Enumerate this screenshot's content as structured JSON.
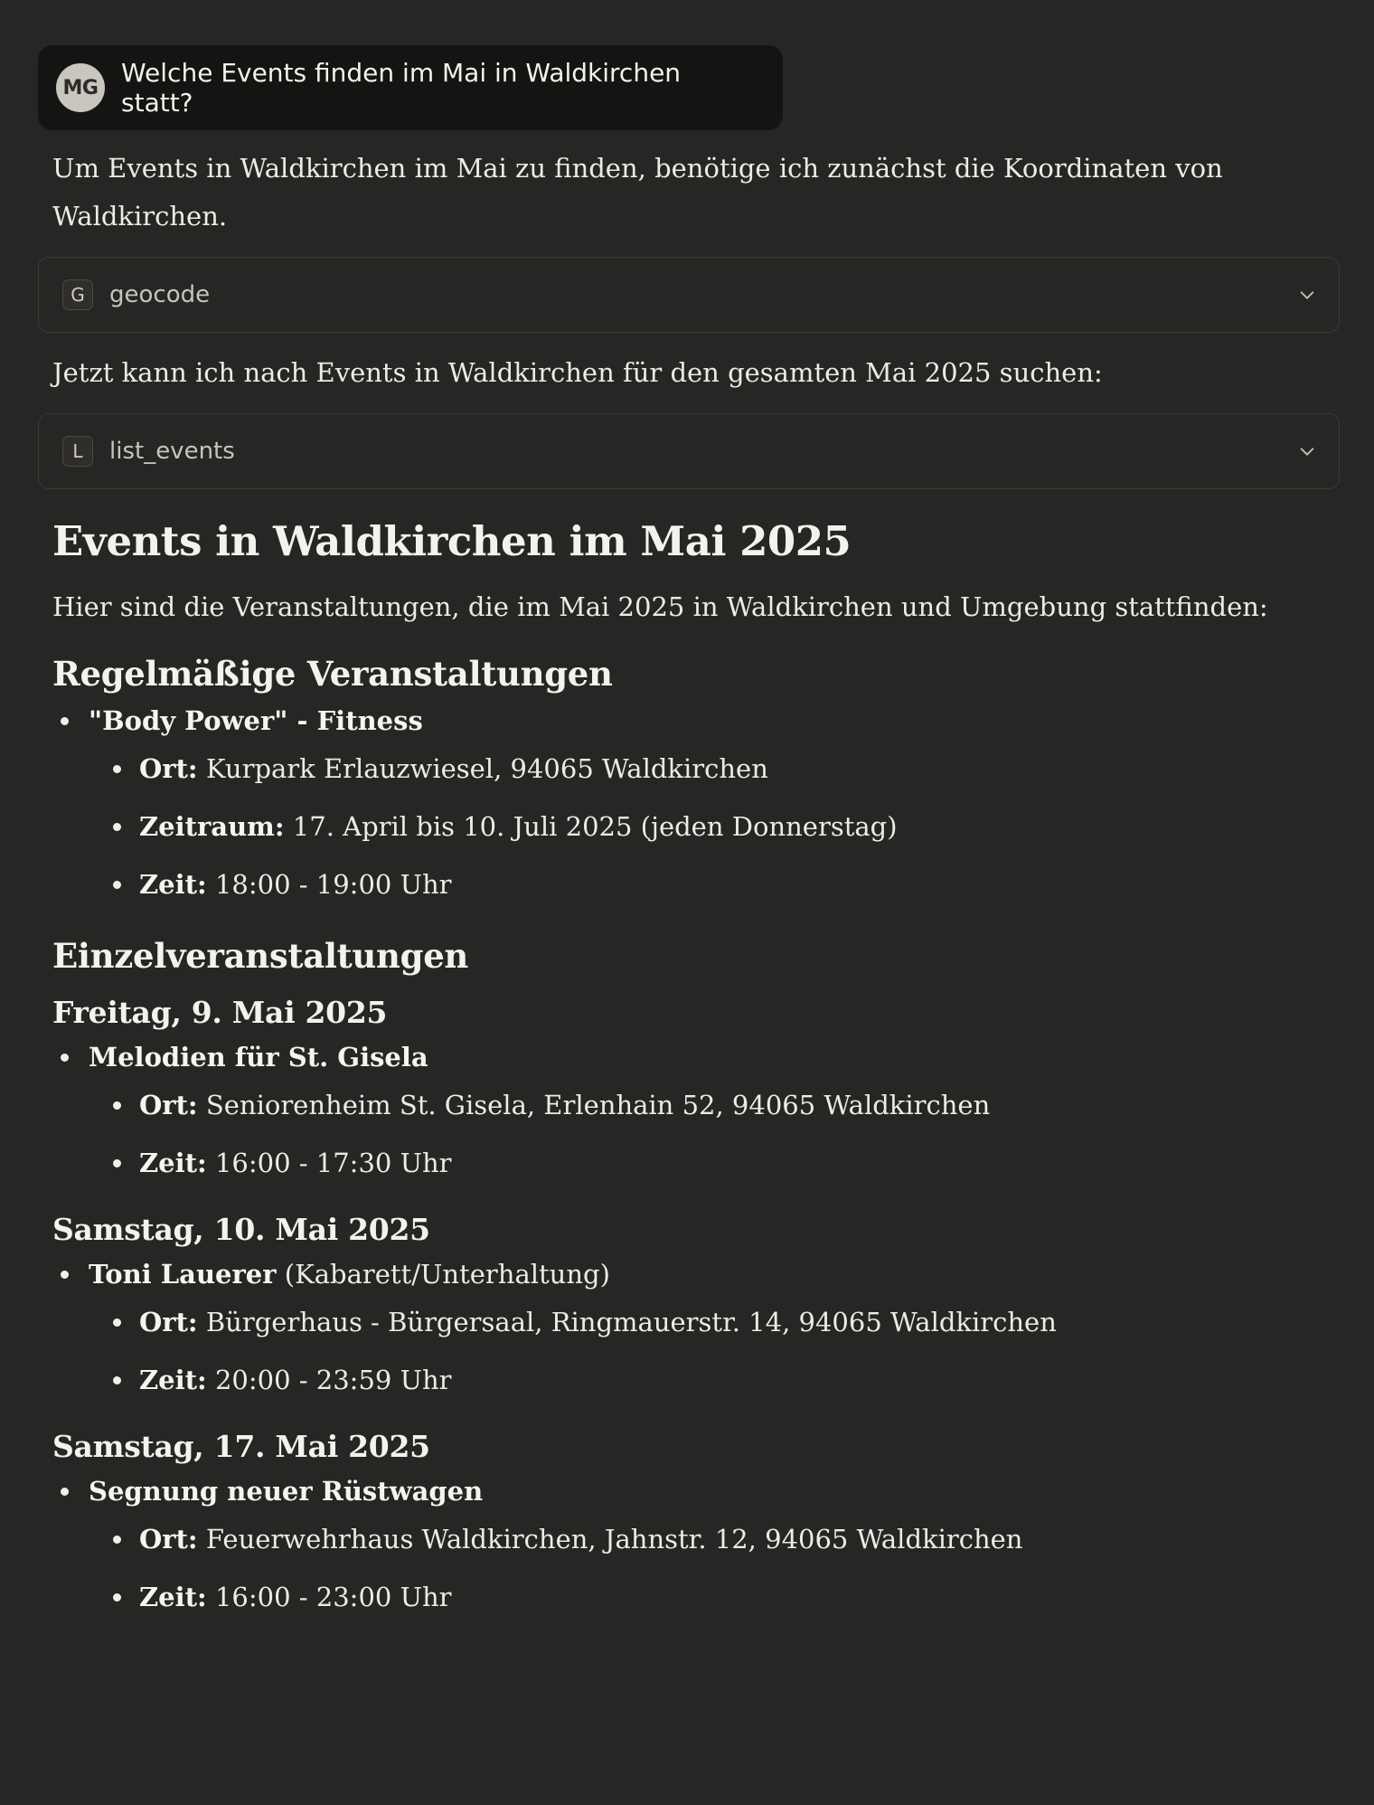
{
  "user_message": {
    "avatar_initials": "MG",
    "text": "Welche Events finden im Mai in Waldkirchen statt?"
  },
  "assistant": {
    "intro_paragraph": "Um Events in Waldkirchen im Mai zu finden, benötige ich zunächst die Koordinaten von Waldkirchen.",
    "tool_calls": [
      {
        "letter": "G",
        "name": "geocode"
      },
      {
        "letter": "L",
        "name": "list_events"
      }
    ],
    "between_paragraph": "Jetzt kann ich nach Events in Waldkirchen für den gesamten Mai 2025 suchen:",
    "heading": "Events in Waldkirchen im Mai 2025",
    "heading_intro": "Hier sind die Veranstaltungen, die im Mai 2025 in Waldkirchen und Umgebung stattfinden:",
    "regular": {
      "title": "Regelmäßige Veranstaltungen",
      "events": [
        {
          "name": "\"Body Power\" - Fitness",
          "details": [
            {
              "label": "Ort:",
              "value": "Kurpark Erlauzwiesel, 94065 Waldkirchen"
            },
            {
              "label": "Zeitraum:",
              "value": "17. April bis 10. Juli 2025 (jeden Donnerstag)"
            },
            {
              "label": "Zeit:",
              "value": "18:00 - 19:00 Uhr"
            }
          ]
        }
      ]
    },
    "single": {
      "title": "Einzelveranstaltungen",
      "days": [
        {
          "date": "Freitag, 9. Mai 2025",
          "event": {
            "name": "Melodien für St. Gisela",
            "suffix": "",
            "details": [
              {
                "label": "Ort:",
                "value": "Seniorenheim St. Gisela, Erlenhain 52, 94065 Waldkirchen"
              },
              {
                "label": "Zeit:",
                "value": "16:00 - 17:30 Uhr"
              }
            ]
          }
        },
        {
          "date": "Samstag, 10. Mai 2025",
          "event": {
            "name": "Toni Lauerer",
            "suffix": "(Kabarett/Unterhaltung)",
            "details": [
              {
                "label": "Ort:",
                "value": "Bürgerhaus - Bürgersaal, Ringmauerstr. 14, 94065 Waldkirchen"
              },
              {
                "label": "Zeit:",
                "value": "20:00 - 23:59 Uhr"
              }
            ]
          }
        },
        {
          "date": "Samstag, 17. Mai 2025",
          "event": {
            "name": "Segnung neuer Rüstwagen",
            "suffix": "",
            "details": [
              {
                "label": "Ort:",
                "value": "Feuerwehrhaus Waldkirchen, Jahnstr. 12, 94065 Waldkirchen"
              },
              {
                "label": "Zeit:",
                "value": "16:00 - 23:00 Uhr"
              }
            ]
          }
        }
      ]
    }
  },
  "colors": {
    "background": "#262624",
    "user_bubble": "#141413",
    "avatar": "#c9c6bd",
    "text": "#f0efe9",
    "tool_border": "#3b3a36"
  },
  "icons": {
    "tool_expand": "chevron-down-icon"
  }
}
